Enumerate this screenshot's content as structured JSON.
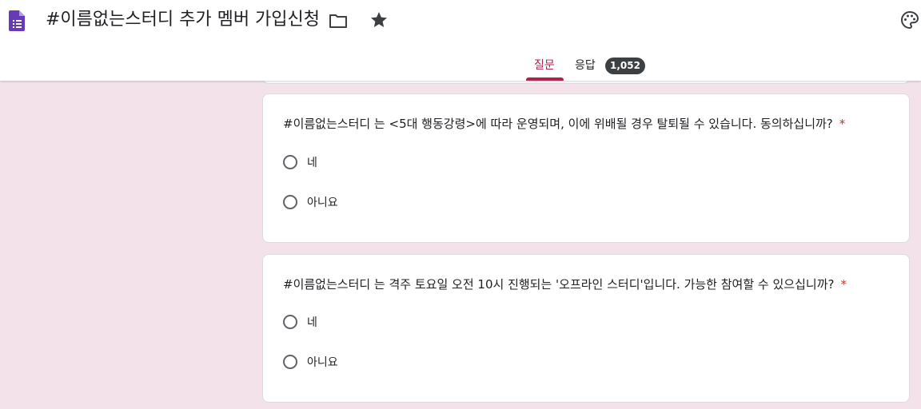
{
  "header": {
    "title": "#이름없는스터디 추가 멤버 가입신청",
    "icons": {
      "document": "document-icon",
      "folder": "folder-icon",
      "star": "star-icon",
      "palette": "palette-icon"
    },
    "accent_color": "#b0214f",
    "doc_icon_color": "#673ab7"
  },
  "tabs": {
    "questions": "질문",
    "responses": "응답",
    "responses_count": "1,052"
  },
  "questions": [
    {
      "title": "#이름없는스터디 는 <5대 행동강령>에 따라 운영되며, 이에 위배될 경우 탈퇴될 수 있습니다. 동의하십니까?",
      "required_mark": "*",
      "options": [
        "네",
        "아니요"
      ]
    },
    {
      "title": "#이름없는스터디 는 격주 토요일 오전 10시 진행되는 '오프라인 스터디'입니다. 가능한 참여할 수 있으십니까?",
      "required_mark": "*",
      "options": [
        "네",
        "아니요"
      ]
    }
  ]
}
